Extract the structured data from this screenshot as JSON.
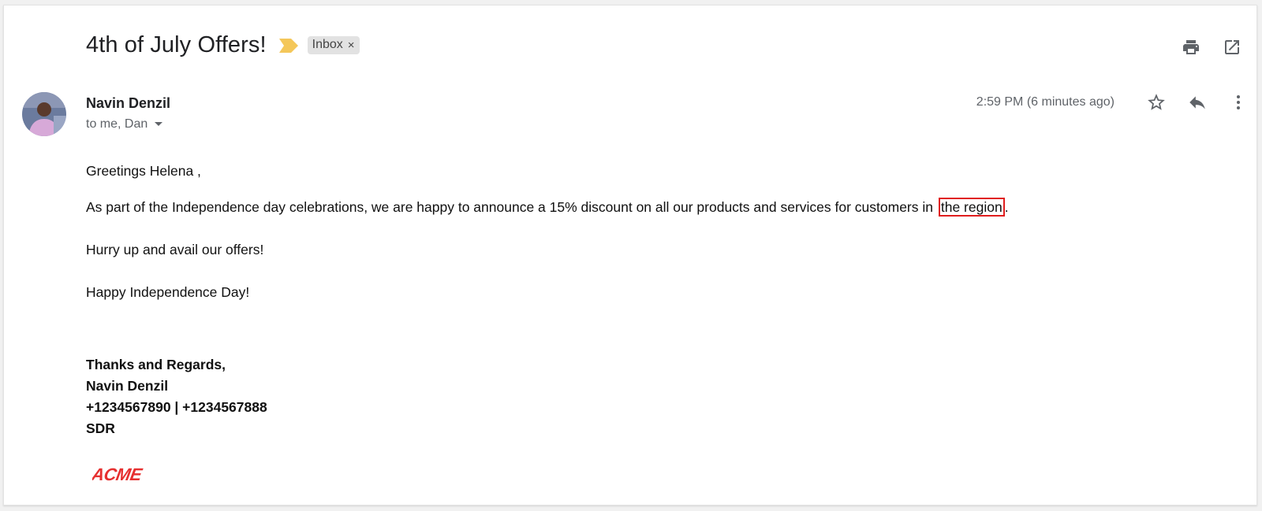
{
  "email": {
    "subject": "4th of July Offers!",
    "label": "Inbox",
    "label_remove": "×",
    "sender_name": "Navin Denzil",
    "recipients": "to me, Dan",
    "timestamp": "2:59 PM (6 minutes ago)",
    "body": {
      "greeting": "Greetings Helena ,",
      "para1_before": "As part of the Independence day celebrations, we are happy to announce a 15% discount on all our products and services for customers in ",
      "para1_highlight": "the  region",
      "para1_after": ".",
      "para2": "Hurry up and avail our offers!",
      "para3": "Happy Independence Day!"
    },
    "signature": {
      "closing": "Thanks and Regards,",
      "name": "Navin Denzil",
      "phones": "+1234567890 | +1234567888",
      "title": "SDR",
      "logo_text": "ACME"
    }
  },
  "icons": {
    "importance": "importance-marker-icon",
    "print": "print-icon",
    "open_new_window": "open-in-new-window-icon",
    "star": "star-icon",
    "reply": "reply-icon",
    "more": "more-vert-icon",
    "dropdown": "caret-down-icon"
  },
  "colors": {
    "importance_marker": "#f4c75a",
    "highlight_border": "#e01e1e",
    "logo": "#e63030",
    "chip_bg": "#e2e2e2"
  }
}
